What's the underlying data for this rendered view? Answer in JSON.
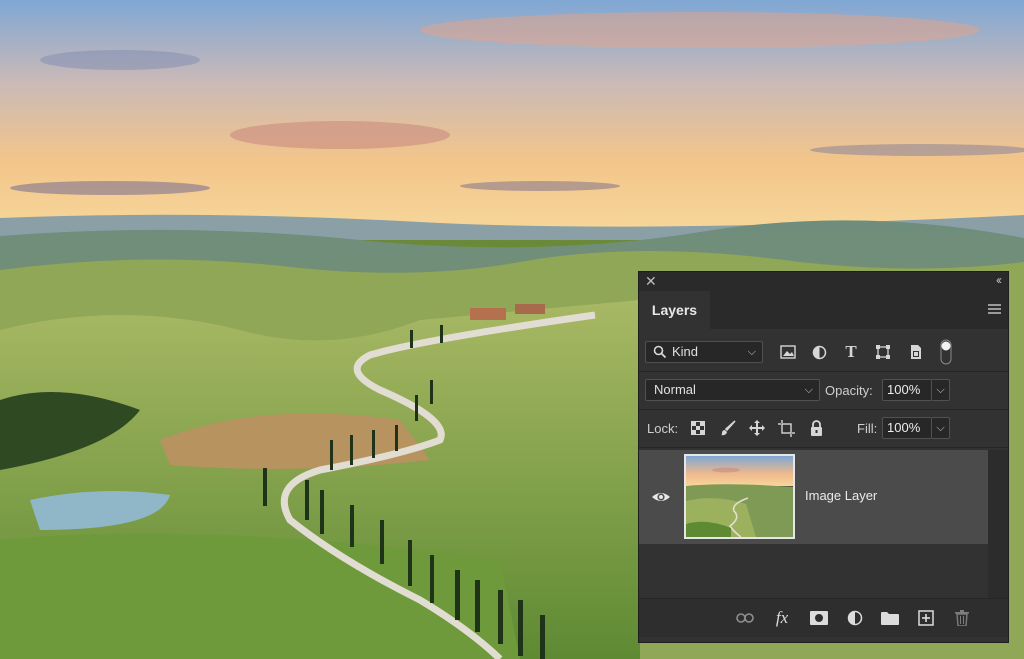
{
  "panel": {
    "title": "Layers",
    "filter": {
      "label": "Kind",
      "icon": "search-icon"
    },
    "filter_icons": [
      "pixel-layer-filter-icon",
      "adjustment-layer-filter-icon",
      "type-layer-filter-icon",
      "shape-layer-filter-icon",
      "smart-object-filter-icon",
      "filter-toggle-icon"
    ],
    "blend_mode": "Normal",
    "opacity_label": "Opacity:",
    "opacity_value": "100%",
    "lock_label": "Lock:",
    "fill_label": "Fill:",
    "fill_value": "100%",
    "layers": [
      {
        "name": "Image Layer",
        "visible": true,
        "selected": true
      }
    ],
    "bottom_icons": [
      "link-layers-icon",
      "layer-style-fx-icon",
      "layer-mask-icon",
      "adjustment-layer-icon",
      "group-folder-icon",
      "new-layer-icon",
      "delete-trash-icon"
    ]
  },
  "colors": {
    "panel_bg": "#323232",
    "selected_row": "#4b4b4b"
  }
}
